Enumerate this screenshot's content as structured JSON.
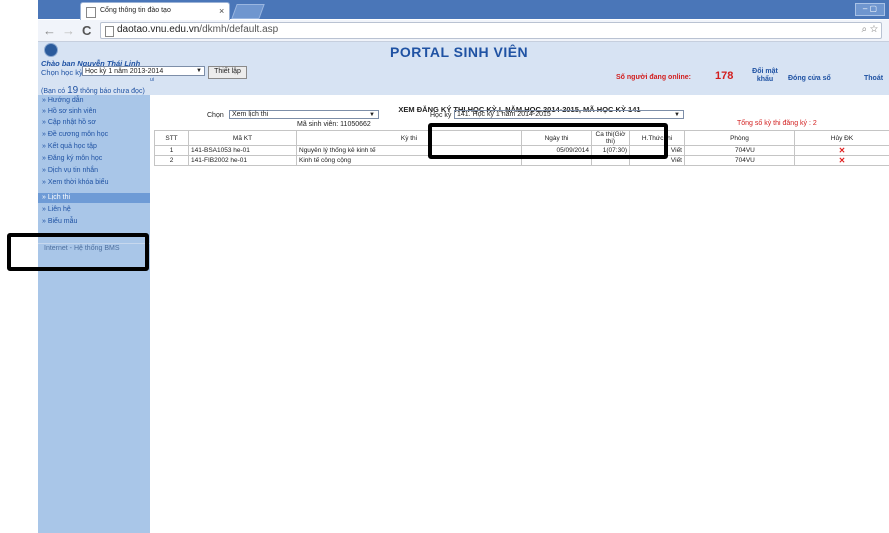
{
  "browser": {
    "tab_title": "Cổng thông tin đào tạo",
    "tab_close": "×",
    "url_host": "daotao.vnu.edu.vn",
    "url_path": "/dkmh/default.asp",
    "window_controls": "– ▢"
  },
  "portal": {
    "title": "PORTAL SINH VIÊN",
    "greeting": "Chào bạn Nguyễn Thái Linh",
    "term_label": "Chọn học kỳ",
    "term_value": "Học kỳ 1 năm 2013-2014",
    "set_button": "Thiết lập",
    "online_label": "Số người đang online:",
    "online_count": "178",
    "change_password": "Đổi mật khẩu",
    "close_window": "Đóng cửa sổ",
    "logout": "Thoát",
    "notice_prefix": "(Bạn có",
    "notice_count": "19",
    "notice_suffix": "thông báo chưa đọc)"
  },
  "sidebar": {
    "items": [
      {
        "label": "» Hướng dẫn"
      },
      {
        "label": "» Hồ sơ sinh viên"
      },
      {
        "label": "» Cập nhật hồ sơ"
      },
      {
        "label": "» Đề cương môn học"
      },
      {
        "label": "» Kết quả học tập"
      },
      {
        "label": "» Đăng ký môn học"
      },
      {
        "label": "» Dịch vụ tin nhắn"
      },
      {
        "label": "» Xem thời khóa biểu"
      },
      {
        "label": "» Lịch thi"
      },
      {
        "label": "» Liên hệ"
      },
      {
        "label": "» Biểu mẫu"
      }
    ],
    "footer": "Internet - Hệ thống BMS"
  },
  "main": {
    "title": "XEM ĐĂNG KÝ THI HỌC KỲ I, NĂM HỌC 2014-2015, MÃ HỌC KỲ 141",
    "choose_label": "Chọn",
    "choose_value": "Xem lịch thi",
    "student_id": "Mã sinh viên: 11050662",
    "term_label": "Học kỳ",
    "term_value": "141. Học kỳ 1 năm 2014-2015",
    "total_registered": "Tổng số kỳ thi đăng ký : 2",
    "table": {
      "headers": [
        "STT",
        "Mã KT",
        "Kỳ thi",
        "Ngày thi",
        "Ca thi(Giờ thi)",
        "H.Thức thi",
        "Phòng",
        "Hủy ĐK"
      ],
      "rows": [
        {
          "stt": "1",
          "code": "141-BSA1053 he-01",
          "name": "Nguyên lý thống kê kinh tế",
          "date": "05/09/2014",
          "shift": "1(07:30)",
          "form": "Viết",
          "room": "704VU",
          "del": "✕"
        },
        {
          "stt": "2",
          "code": "141-FIB2002 he-01",
          "name": "Kinh tế công cộng",
          "date": "",
          "shift": "",
          "form": "Viết",
          "room": "704VU",
          "del": "✕"
        }
      ]
    }
  }
}
